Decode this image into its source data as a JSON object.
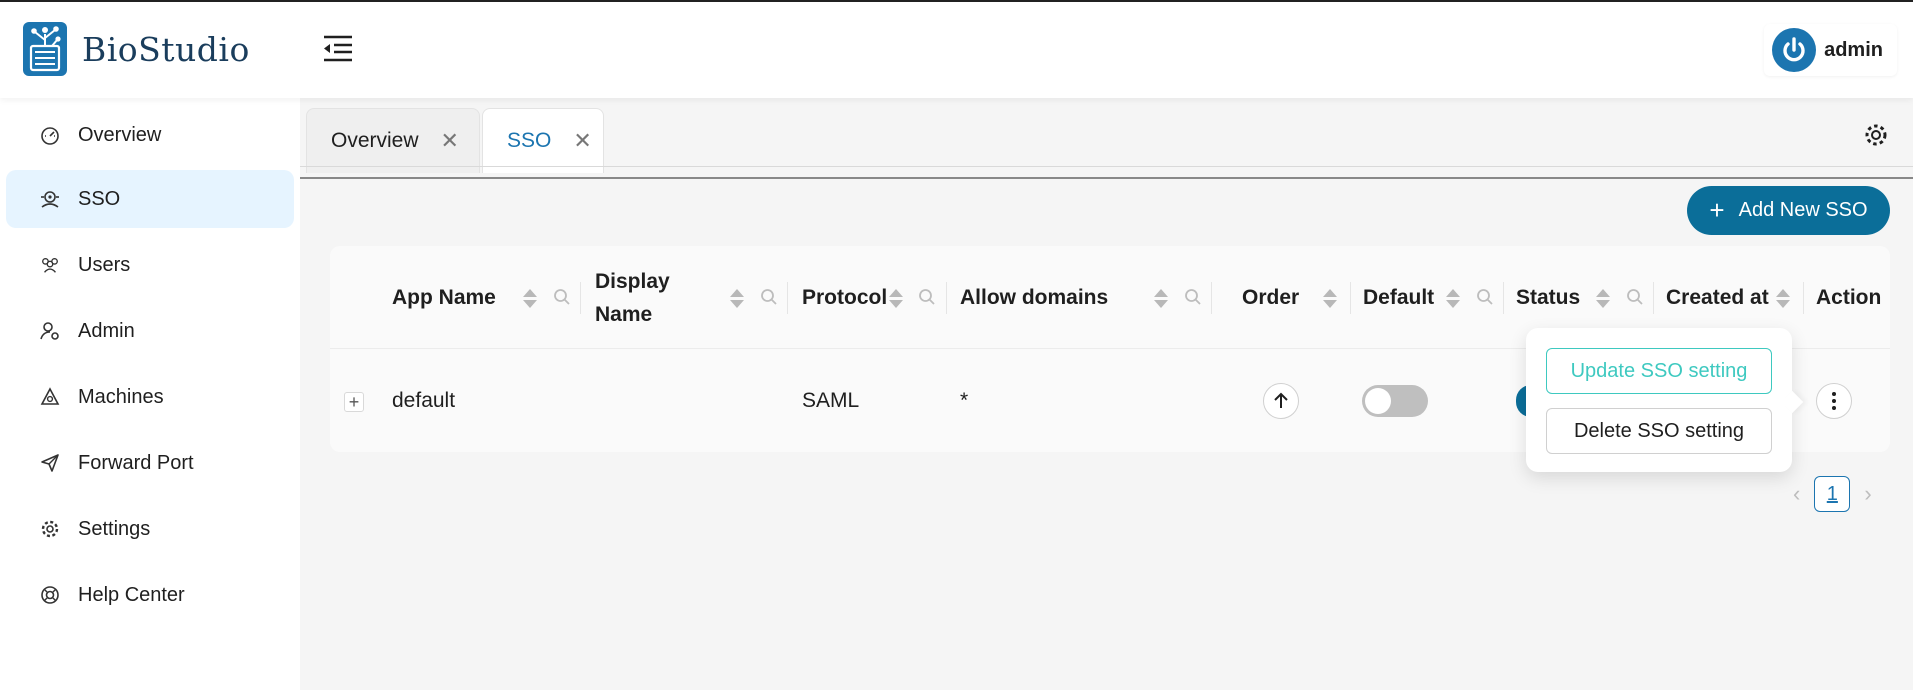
{
  "app": {
    "name": "BioStudio"
  },
  "user": {
    "name": "admin"
  },
  "sidebar": {
    "items": [
      {
        "label": "Overview",
        "icon": "dashboard-icon"
      },
      {
        "label": "SSO",
        "icon": "sso-icon",
        "active": true
      },
      {
        "label": "Users",
        "icon": "users-icon"
      },
      {
        "label": "Admin",
        "icon": "admin-icon"
      },
      {
        "label": "Machines",
        "icon": "machines-icon"
      },
      {
        "label": "Forward Port",
        "icon": "send-icon"
      },
      {
        "label": "Settings",
        "icon": "gear-icon"
      },
      {
        "label": "Help Center",
        "icon": "help-icon"
      }
    ]
  },
  "tabs": [
    {
      "label": "Overview",
      "active": false
    },
    {
      "label": "SSO",
      "active": true
    }
  ],
  "toolbar": {
    "add_label": "Add New SSO"
  },
  "table": {
    "columns": [
      "App Name",
      "Display Name",
      "Protocol",
      "Allow domains",
      "Order",
      "Default",
      "Status",
      "Created at",
      "Action"
    ],
    "display_name_lines": [
      "Display",
      "Name"
    ],
    "rows": [
      {
        "app_name": "default",
        "display_name": "",
        "protocol": "SAML",
        "allow_domains": "*",
        "default": false,
        "status": true
      }
    ]
  },
  "popover": {
    "update_label": "Update SSO setting",
    "delete_label": "Delete SSO setting"
  },
  "pagination": {
    "current": "1"
  },
  "colors": {
    "primary": "#0b6e99",
    "accent": "#1c75b0",
    "teal": "#3ec9c0",
    "active_bg": "#e6f4ff"
  }
}
